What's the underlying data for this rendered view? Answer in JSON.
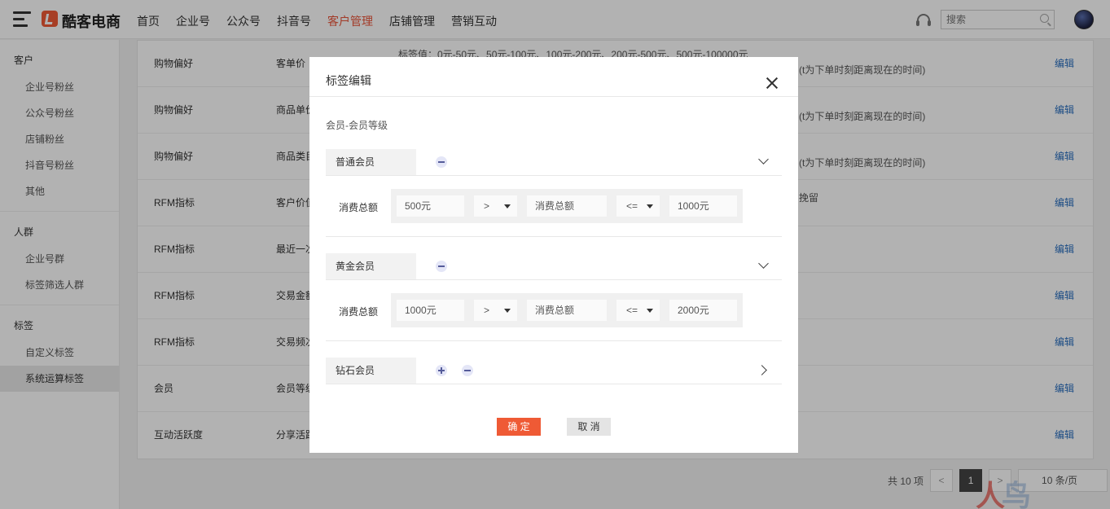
{
  "header": {
    "brand": "酷客电商",
    "nav": [
      "首页",
      "企业号",
      "公众号",
      "抖音号",
      "客户管理",
      "店铺管理",
      "营销互动"
    ],
    "active_nav": "客户管理",
    "search_placeholder": "搜索"
  },
  "sidebar": {
    "groups": [
      {
        "title": "客户",
        "items": [
          "企业号粉丝",
          "公众号粉丝",
          "店铺粉丝",
          "抖音号粉丝",
          "其他"
        ]
      },
      {
        "title": "人群",
        "items": [
          "企业号群",
          "标签筛选人群"
        ]
      },
      {
        "title": "标签",
        "items": [
          "自定义标签",
          "系统运算标签"
        ]
      }
    ],
    "active_item": "系统运算标签"
  },
  "table": {
    "rows": [
      {
        "category": "购物偏好",
        "name": "客单价",
        "desc": "标签值：0元-50元、50元-100元、100元-200元、200元-500元、500元-100000元",
        "desc2": "(t为下单时刻距离现在的时间)",
        "action": "编辑"
      },
      {
        "category": "购物偏好",
        "name": "商品单价",
        "desc": "",
        "desc2": "(t为下单时刻距离现在的时间)",
        "action": "编辑"
      },
      {
        "category": "购物偏好",
        "name": "商品类目",
        "desc": "",
        "desc2": "(t为下单时刻距离现在的时间)",
        "action": "编辑"
      },
      {
        "category": "RFM指标",
        "name": "客户价值",
        "desc": "",
        "desc2": "挽留",
        "action": "编辑"
      },
      {
        "category": "RFM指标",
        "name": "最近一次",
        "desc": "",
        "desc2": "",
        "action": "编辑"
      },
      {
        "category": "RFM指标",
        "name": "交易金额",
        "desc": "",
        "desc2": "",
        "action": "编辑"
      },
      {
        "category": "RFM指标",
        "name": "交易频次",
        "desc": "",
        "desc2": "",
        "action": "编辑"
      },
      {
        "category": "会员",
        "name": "会员等级",
        "desc": "",
        "desc2": "",
        "action": "编辑"
      },
      {
        "category": "互动活跃度",
        "name": "分享活跃",
        "desc": "",
        "desc2": "",
        "action": "编辑"
      }
    ]
  },
  "pagination": {
    "total": "共 10 项",
    "prev": "<",
    "current_page": "1",
    "next": ">",
    "page_size": "10 条/页"
  },
  "modal": {
    "title": "标签编辑",
    "subtitle": "会员-会员等级",
    "levels": [
      {
        "name": "普通会员",
        "condition": {
          "label": "消费总额",
          "min": "500元",
          "op1": ">",
          "metric": "消费总额",
          "op2": "<=",
          "max": "1000元"
        }
      },
      {
        "name": "黄金会员",
        "condition": {
          "label": "消费总额",
          "min": "1000元",
          "op1": ">",
          "metric": "消费总额",
          "op2": "<=",
          "max": "2000元"
        }
      },
      {
        "name": "钻石会员"
      }
    ],
    "ok_label": "确 定",
    "cancel_label": "取 消"
  },
  "colors": {
    "accent": "#ef5a35",
    "link": "#2a6fbf"
  }
}
